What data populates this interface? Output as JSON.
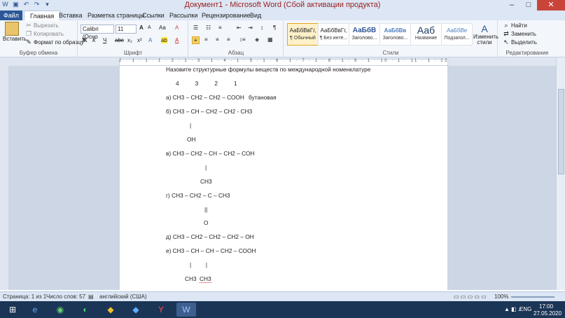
{
  "window": {
    "title": "Документ1 - Microsoft Word (Сбой активации продукта)",
    "minimize": "–",
    "maximize": "□",
    "close": "✕"
  },
  "qat": {
    "word": "W",
    "save": "▣",
    "undo": "↶",
    "redo": "↷",
    "customize": "▾"
  },
  "tabs": [
    "Файл",
    "Главная",
    "Вставка",
    "Разметка страницы",
    "Ссылки",
    "Рассылки",
    "Рецензирование",
    "Вид"
  ],
  "ribbon": {
    "clipboard": {
      "paste": "Вставить",
      "cut": "Вырезать",
      "copy": "Копировать",
      "format": "Формат по образцу",
      "label": "Буфер обмена"
    },
    "font": {
      "name": "Calibri (Осно",
      "size": "11",
      "bold": "Ж",
      "italic": "К",
      "underline": "Ч",
      "strike": "abc",
      "sub": "x₂",
      "sup": "x²",
      "grow": "A",
      "shrink": "A",
      "case": "Aa",
      "clear": "A",
      "highlight": "ab",
      "color": "A",
      "label": "Шрифт"
    },
    "paragraph": {
      "label": "Абзац",
      "pilcrow": "¶"
    },
    "styles": {
      "items": [
        {
          "sample": "АаБбВвГг,",
          "name": "¶ Обычный"
        },
        {
          "sample": "АаБбВвГг,",
          "name": "¶ Без инте..."
        },
        {
          "sample": "АаБбВ",
          "name": "Заголово..."
        },
        {
          "sample": "АаБбВв",
          "name": "Заголово..."
        },
        {
          "sample": "Ааб",
          "name": "Название"
        },
        {
          "sample": "АаБбВе",
          "name": "Подзагол..."
        }
      ],
      "change": "Изменить стили",
      "label": "Стили"
    },
    "editing": {
      "find": "Найти",
      "replace": "Заменить",
      "select": "Выделить",
      "label": "Редактирование"
    }
  },
  "ruler": {
    "numbers": "2 · 1 · 1 · 1 · 2 · 1 · 3 · 1 · 4 · 1 · 5 · 1 · 6 · 1 · 7 · 1 · 8 · 1 · 9 · 1 · 10 · 1 · 11 · 1 · 12 · 1 · 13 · 1 · 14 · 1 · 15 · 1 · 16 · △ · 17"
  },
  "document": {
    "heading": "Назовите структурные формулы веществ по международной номенклатуре",
    "numbers": "4          3          2          1",
    "a": "а) СН3 – СН2 – СН2 – СООН",
    "a_name": "бутановая",
    "b": "б) СН3 – СН – СН2 – СН2 - СН3",
    "bar": "|",
    "oh": "ОН",
    "v": "в) СН3 – СН2 – СН – СН2 – СОН",
    "ch3": "СН3",
    "g": "г) СН3 – СН2 – С – СН3",
    "dbl": "||",
    "o": "О",
    "d": "д) СН3 – СН2 – СН2 – СН2 – ОН",
    "e": "е) СН3 – СН – СН – СН2 – СООН",
    "bars2": "|         |",
    "ch3a": "СН3",
    "ch3b": "СН3"
  },
  "status": {
    "page": "Страница: 1 из 1",
    "words": "Число слов: 57",
    "lang": "английский (США)",
    "zoom": "100%"
  },
  "taskbar": {
    "start": "⊞",
    "apps": [
      "e",
      "◉",
      "◐",
      "◆",
      "Y",
      "W"
    ],
    "lang": "ENG",
    "time": "17:00",
    "date": "27.05.2020"
  }
}
